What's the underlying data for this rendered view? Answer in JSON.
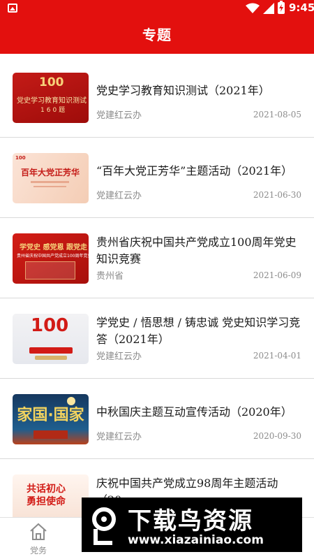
{
  "status_bar": {
    "time": "9:45",
    "icons": [
      "image-icon",
      "wifi-icon",
      "signal-icon",
      "battery-icon"
    ]
  },
  "header": {
    "title": "专题"
  },
  "topics": [
    {
      "title": "党史学习教育知识测试（2021年）",
      "source": "党建红云办",
      "date": "2021-08-05",
      "thumb_text": [
        "100",
        "党史学习教育知识测试",
        "160题"
      ]
    },
    {
      "title": "“百年大党正芳华”主题活动（2021年）",
      "source": "党建红云办",
      "date": "2021-06-30",
      "thumb_text": [
        "100",
        "百年大党正芳华"
      ]
    },
    {
      "title": "贵州省庆祝中国共产党成立100周年党史知识竞赛",
      "source": "贵州省",
      "date": "2021-06-09",
      "thumb_text": [
        "学党史 感党恩 跟党走",
        "贵州省庆祝中国共产党成立100周年党史知识竞赛"
      ]
    },
    {
      "title": "学党史 / 悟思想 / 铸忠诚 党史知识学习竞答（2021年）",
      "source": "党建红云办",
      "date": "2021-04-01",
      "thumb_text": [
        "100"
      ]
    },
    {
      "title": "中秋国庆主题互动宣传活动（2020年）",
      "source": "党建红云办",
      "date": "2020-09-30",
      "thumb_text": [
        "家国·国家"
      ]
    },
    {
      "title": "庆祝中国共产党成立98周年主题活动（20",
      "source": "",
      "date": "",
      "thumb_text": [
        "共话初心",
        "勇担使命"
      ]
    }
  ],
  "bottom_nav": {
    "items": [
      {
        "label": "党务",
        "icon": "home-icon"
      }
    ]
  },
  "watermark": {
    "title": "下载鸟资源",
    "url": "www.xiazainiao.com"
  },
  "colors": {
    "brand_red": "#e3100e",
    "text_primary": "#1a1a1a",
    "text_secondary": "#8c8c8c",
    "divider": "#d9d9d9"
  }
}
